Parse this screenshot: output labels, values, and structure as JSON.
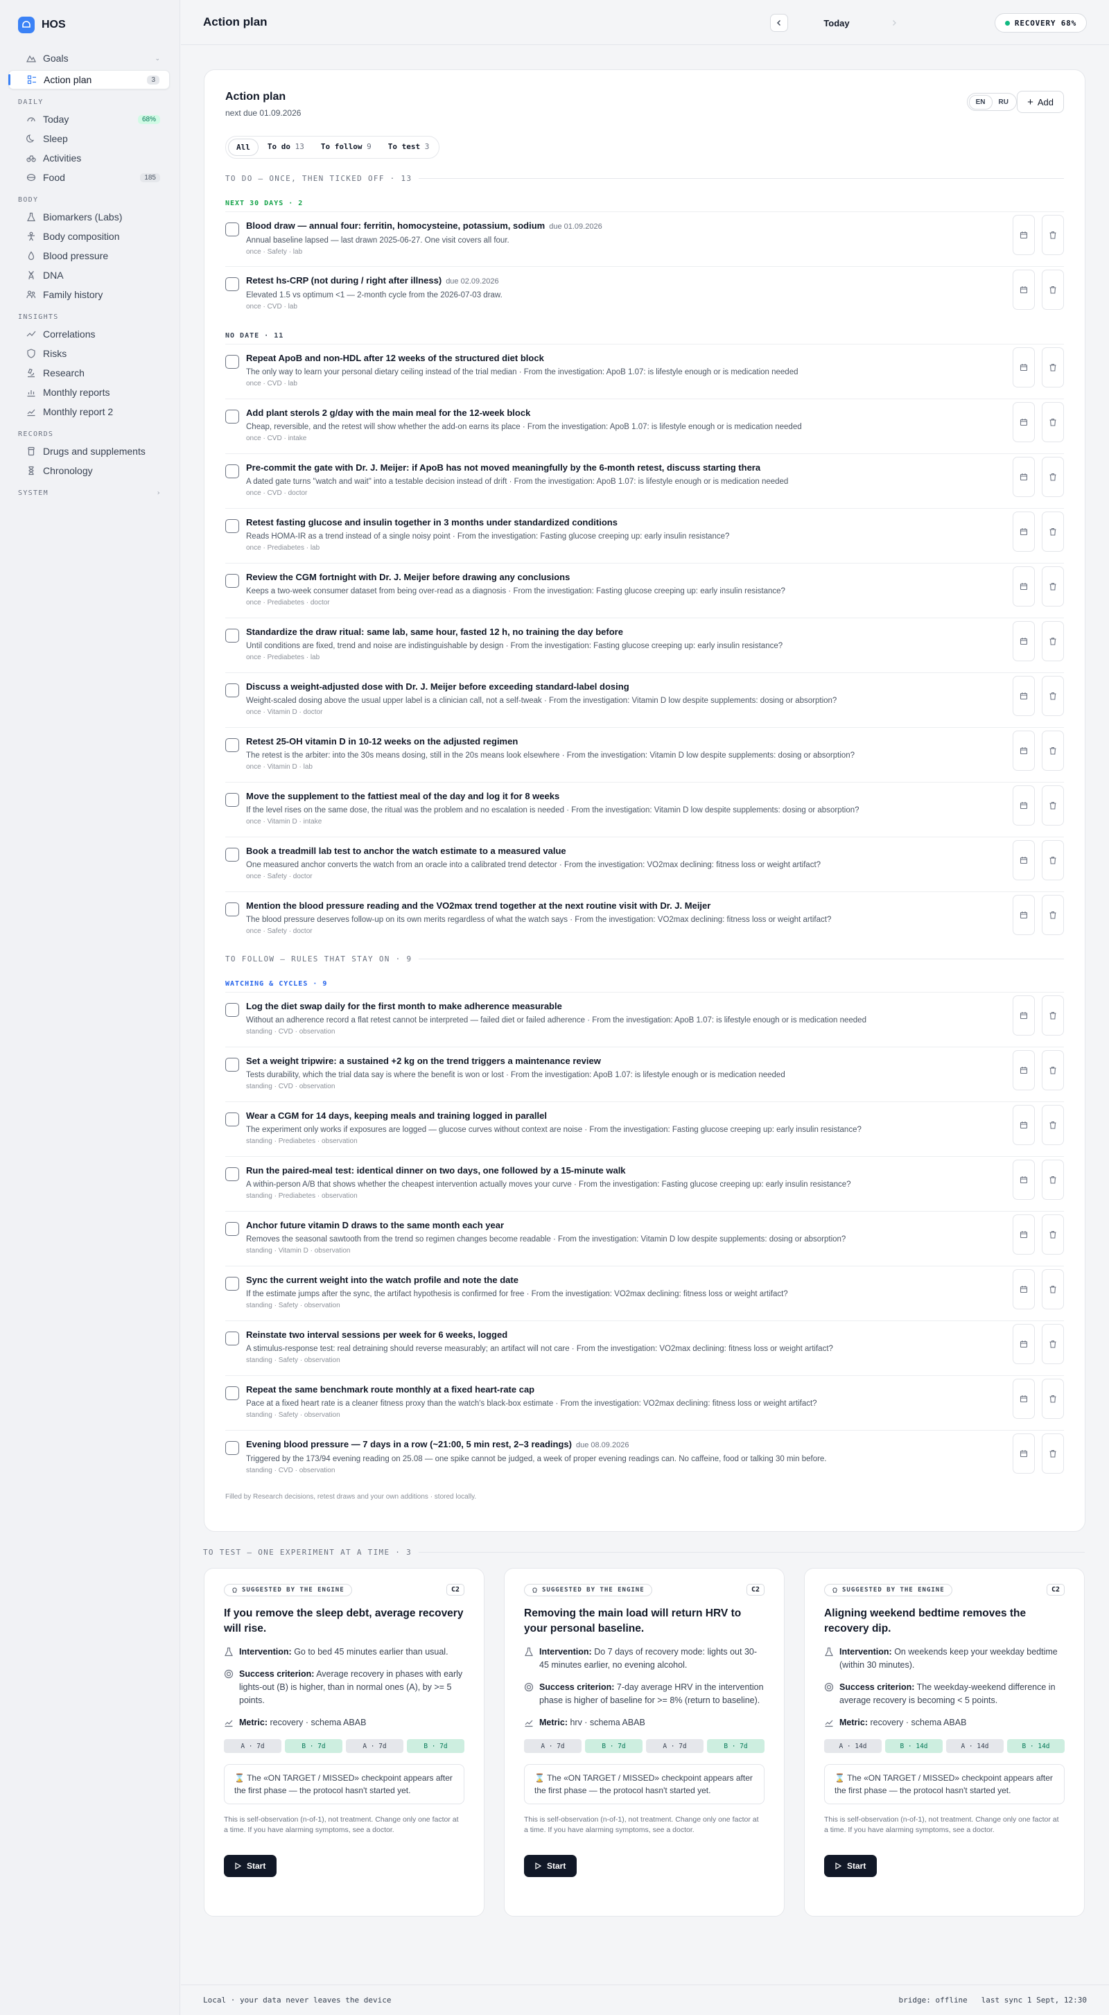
{
  "app": {
    "name": "HOS"
  },
  "sidebar": {
    "top": [
      {
        "label": "Goals",
        "icon": "goals-icon"
      },
      {
        "label": "Action plan",
        "icon": "action-plan-icon",
        "badge": "3"
      }
    ],
    "daily_h": "DAILY",
    "daily": [
      {
        "label": "Today",
        "badge": "68%"
      },
      {
        "label": "Sleep"
      },
      {
        "label": "Activities"
      },
      {
        "label": "Food",
        "badge": "185"
      }
    ],
    "body_h": "BODY",
    "body": [
      {
        "label": "Biomarkers (Labs)"
      },
      {
        "label": "Body composition"
      },
      {
        "label": "Blood pressure"
      },
      {
        "label": "DNA"
      },
      {
        "label": "Family history"
      }
    ],
    "insights_h": "INSIGHTS",
    "insights": [
      {
        "label": "Correlations"
      },
      {
        "label": "Risks"
      },
      {
        "label": "Research"
      },
      {
        "label": "Monthly reports"
      },
      {
        "label": "Monthly report 2"
      }
    ],
    "records_h": "RECORDS",
    "records": [
      {
        "label": "Drugs and supplements"
      },
      {
        "label": "Chronology"
      }
    ],
    "system_h": "SYSTEM"
  },
  "header": {
    "title": "Action plan",
    "date_label": "Today",
    "recovery": "RECOVERY 68%"
  },
  "plan": {
    "title": "Action plan",
    "subtitle": "next due 01.09.2026",
    "lang": [
      "EN",
      "RU"
    ],
    "add_label": "Add",
    "filters": [
      {
        "label": "All",
        "count": ""
      },
      {
        "label": "To do",
        "count": "13"
      },
      {
        "label": "To follow",
        "count": "9"
      },
      {
        "label": "To test",
        "count": "3"
      }
    ],
    "todo_h": "TO DO — ONCE, THEN TICKED OFF · 13",
    "next30_h": "NEXT 30 DAYS · 2",
    "next30": [
      {
        "title": "Blood draw — annual four: ferritin, homocysteine, potassium, sodium",
        "due": "due 01.09.2026",
        "desc": "Annual baseline lapsed — last drawn 2025-06-27. One visit covers all four.",
        "meta": "once · Safety · lab"
      },
      {
        "title": "Retest hs-CRP (not during / right after illness)",
        "due": "due 02.09.2026",
        "desc": "Elevated 1.5 vs optimum <1 — 2-month cycle from the 2026-07-03 draw.",
        "meta": "once · CVD · lab"
      }
    ],
    "nodate_h": "NO DATE · 11",
    "nodate": [
      {
        "title": "Repeat ApoB and non-HDL after 12 weeks of the structured diet block",
        "desc": "The only way to learn your personal dietary ceiling instead of the trial median · From the investigation: ApoB 1.07: is lifestyle enough or is medication needed",
        "meta": "once · CVD · lab"
      },
      {
        "title": "Add plant sterols 2 g/day with the main meal for the 12-week block",
        "desc": "Cheap, reversible, and the retest will show whether the add-on earns its place · From the investigation: ApoB 1.07: is lifestyle enough or is medication needed",
        "meta": "once · CVD · intake"
      },
      {
        "title": "Pre-commit the gate with Dr. J. Meijer: if ApoB has not moved meaningfully by the 6-month retest, discuss starting thera",
        "desc": "A dated gate turns \"watch and wait\" into a testable decision instead of drift · From the investigation: ApoB 1.07: is lifestyle enough or is medication needed",
        "meta": "once · CVD · doctor"
      },
      {
        "title": "Retest fasting glucose and insulin together in 3 months under standardized conditions",
        "desc": "Reads HOMA-IR as a trend instead of a single noisy point · From the investigation: Fasting glucose creeping up: early insulin resistance?",
        "meta": "once · Prediabetes · lab"
      },
      {
        "title": "Review the CGM fortnight with Dr. J. Meijer before drawing any conclusions",
        "desc": "Keeps a two-week consumer dataset from being over-read as a diagnosis · From the investigation: Fasting glucose creeping up: early insulin resistance?",
        "meta": "once · Prediabetes · doctor"
      },
      {
        "title": "Standardize the draw ritual: same lab, same hour, fasted 12 h, no training the day before",
        "desc": "Until conditions are fixed, trend and noise are indistinguishable by design · From the investigation: Fasting glucose creeping up: early insulin resistance?",
        "meta": "once · Prediabetes · lab"
      },
      {
        "title": "Discuss a weight-adjusted dose with Dr. J. Meijer before exceeding standard-label dosing",
        "desc": "Weight-scaled dosing above the usual upper label is a clinician call, not a self-tweak · From the investigation: Vitamin D low despite supplements: dosing or absorption?",
        "meta": "once · Vitamin D · doctor"
      },
      {
        "title": "Retest 25-OH vitamin D in 10-12 weeks on the adjusted regimen",
        "desc": "The retest is the arbiter: into the 30s means dosing, still in the 20s means look elsewhere · From the investigation: Vitamin D low despite supplements: dosing or absorption?",
        "meta": "once · Vitamin D · lab"
      },
      {
        "title": "Move the supplement to the fattiest meal of the day and log it for 8 weeks",
        "desc": "If the level rises on the same dose, the ritual was the problem and no escalation is needed · From the investigation: Vitamin D low despite supplements: dosing or absorption?",
        "meta": "once · Vitamin D · intake"
      },
      {
        "title": "Book a treadmill lab test to anchor the watch estimate to a measured value",
        "desc": "One measured anchor converts the watch from an oracle into a calibrated trend detector · From the investigation: VO2max declining: fitness loss or weight artifact?",
        "meta": "once · Safety · doctor"
      },
      {
        "title": "Mention the blood pressure reading and the VO2max trend together at the next routine visit with Dr. J. Meijer",
        "desc": "The blood pressure deserves follow-up on its own merits regardless of what the watch says · From the investigation: VO2max declining: fitness loss or weight artifact?",
        "meta": "once · Safety · doctor"
      }
    ],
    "follow_h": "TO FOLLOW — RULES THAT STAY ON · 9",
    "watch_h": "WATCHING & CYCLES · 9",
    "follow": [
      {
        "title": "Log the diet swap daily for the first month to make adherence measurable",
        "desc": "Without an adherence record a flat retest cannot be interpreted — failed diet or failed adherence · From the investigation: ApoB 1.07: is lifestyle enough or is medication needed",
        "meta": "standing · CVD · observation"
      },
      {
        "title": "Set a weight tripwire: a sustained +2 kg on the trend triggers a maintenance review",
        "desc": "Tests durability, which the trial data say is where the benefit is won or lost · From the investigation: ApoB 1.07: is lifestyle enough or is medication needed",
        "meta": "standing · CVD · observation"
      },
      {
        "title": "Wear a CGM for 14 days, keeping meals and training logged in parallel",
        "desc": "The experiment only works if exposures are logged — glucose curves without context are noise · From the investigation: Fasting glucose creeping up: early insulin resistance?",
        "meta": "standing · Prediabetes · observation"
      },
      {
        "title": "Run the paired-meal test: identical dinner on two days, one followed by a 15-minute walk",
        "desc": "A within-person A/B that shows whether the cheapest intervention actually moves your curve · From the investigation: Fasting glucose creeping up: early insulin resistance?",
        "meta": "standing · Prediabetes · observation"
      },
      {
        "title": "Anchor future vitamin D draws to the same month each year",
        "desc": "Removes the seasonal sawtooth from the trend so regimen changes become readable · From the investigation: Vitamin D low despite supplements: dosing or absorption?",
        "meta": "standing · Vitamin D · observation"
      },
      {
        "title": "Sync the current weight into the watch profile and note the date",
        "desc": "If the estimate jumps after the sync, the artifact hypothesis is confirmed for free · From the investigation: VO2max declining: fitness loss or weight artifact?",
        "meta": "standing · Safety · observation"
      },
      {
        "title": "Reinstate two interval sessions per week for 6 weeks, logged",
        "desc": "A stimulus-response test: real detraining should reverse measurably; an artifact will not care · From the investigation: VO2max declining: fitness loss or weight artifact?",
        "meta": "standing · Safety · observation"
      },
      {
        "title": "Repeat the same benchmark route monthly at a fixed heart-rate cap",
        "desc": "Pace at a fixed heart rate is a cleaner fitness proxy than the watch's black-box estimate · From the investigation: VO2max declining: fitness loss or weight artifact?",
        "meta": "standing · Safety · observation"
      },
      {
        "title": "Evening blood pressure — 7 days in a row (~21:00, 5 min rest, 2–3 readings)",
        "due": "due 08.09.2026",
        "desc": "Triggered by the 173/94 evening reading on 25.08 — one spike cannot be judged, a week of proper evening readings can. No caffeine, food or talking 30 min before.",
        "meta": "standing · CVD · observation"
      }
    ],
    "footnote": "Filled by Research decisions, retest draws and your own additions · stored locally."
  },
  "tests": {
    "heading": "TO TEST — ONE EXPERIMENT AT A TIME · 3",
    "cards": [
      {
        "tag": "SUGGESTED BY THE ENGINE",
        "level": "C2",
        "title": "If you remove the sleep debt, average recovery will rise.",
        "intervention_label": "Intervention:",
        "intervention": "Go to bed 45 minutes earlier than usual.",
        "success_label": "Success criterion:",
        "success": "Average recovery in phases with early lights-out (B) is higher, than in normal ones (A), by >= 5 points.",
        "metric_label": "Metric:",
        "metric": "recovery · schema ABAB",
        "phases": [
          "A · 7d",
          "B · 7d",
          "A · 7d",
          "B · 7d"
        ],
        "note": "The «ON TARGET / MISSED» checkpoint appears after the first phase — the protocol hasn't started yet.",
        "disclaimer": "This is self-observation (n-of-1), not treatment. Change only one factor at a time. If you have alarming symptoms, see a doctor.",
        "start": "Start"
      },
      {
        "tag": "SUGGESTED BY THE ENGINE",
        "level": "C2",
        "title": "Removing the main load will return HRV to your personal baseline.",
        "intervention_label": "Intervention:",
        "intervention": "Do 7 days of recovery mode: lights out 30-45 minutes earlier, no evening alcohol.",
        "success_label": "Success criterion:",
        "success": "7-day average HRV in the intervention phase is higher of baseline for >= 8% (return to baseline).",
        "metric_label": "Metric:",
        "metric": "hrv · schema ABAB",
        "phases": [
          "A · 7d",
          "B · 7d",
          "A · 7d",
          "B · 7d"
        ],
        "note": "The «ON TARGET / MISSED» checkpoint appears after the first phase — the protocol hasn't started yet.",
        "disclaimer": "This is self-observation (n-of-1), not treatment. Change only one factor at a time. If you have alarming symptoms, see a doctor.",
        "start": "Start"
      },
      {
        "tag": "SUGGESTED BY THE ENGINE",
        "level": "C2",
        "title": "Aligning weekend bedtime removes the recovery dip.",
        "intervention_label": "Intervention:",
        "intervention": "On weekends keep your weekday bedtime (within 30 minutes).",
        "success_label": "Success criterion:",
        "success": "The weekday-weekend difference in average recovery is becoming < 5 points.",
        "metric_label": "Metric:",
        "metric": "recovery · schema ABAB",
        "phases": [
          "A · 14d",
          "B · 14d",
          "A · 14d",
          "B · 14d"
        ],
        "note": "The «ON TARGET / MISSED» checkpoint appears after the first phase — the protocol hasn't started yet.",
        "disclaimer": "This is self-observation (n-of-1), not treatment. Change only one factor at a time. If you have alarming symptoms, see a doctor.",
        "start": "Start"
      }
    ]
  },
  "footer": {
    "left": "Local · your data never leaves the device",
    "right": "bridge: offline   last sync 1 Sept, 12:30"
  }
}
